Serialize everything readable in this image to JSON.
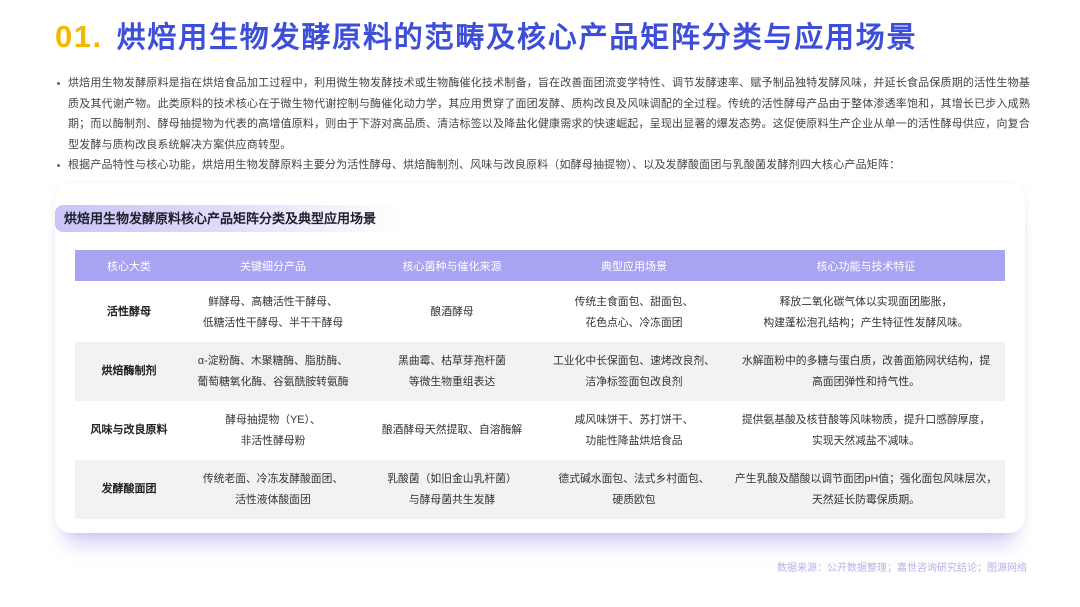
{
  "slide": {
    "number": "01.",
    "title": "烘焙用生物发酵原料的范畴及核心产品矩阵分类与应用场景"
  },
  "bullets": [
    "烘焙用生物发酵原料是指在烘焙食品加工过程中，利用微生物发酵技术或生物酶催化技术制备，旨在改善面团流变学特性、调节发酵速率、赋予制品独特发酵风味，并延长食品保质期的活性生物基质及其代谢产物。此类原料的技术核心在于微生物代谢控制与酶催化动力学，其应用贯穿了面团发酵、质构改良及风味调配的全过程。传统的活性酵母产品由于整体渗透率饱和，其增长已步入成熟期；而以酶制剂、酵母抽提物为代表的高增值原料，则由于下游对高品质、清洁标签以及降盐化健康需求的快速崛起，呈现出显著的爆发态势。这促使原料生产企业从单一的活性酵母供应，向复合型发酵与质构改良系统解决方案供应商转型。",
    "根据产品特性与核心功能，烘焙用生物发酵原料主要分为活性酵母、烘焙酶制剂、风味与改良原料（如酵母抽提物）、以及发酵酸面团与乳酸菌发酵剂四大核心产品矩阵："
  ],
  "card": {
    "title": "烘焙用生物发酵原料核心产品矩阵分类及典型应用场景",
    "table": {
      "headers": [
        "核心大类",
        "关键细分产品",
        "核心菌种与催化来源",
        "典型应用场景",
        "核心功能与技术特征"
      ],
      "rows": [
        [
          "活性酵母",
          "鲜酵母、高糖活性干酵母、\n低糖活性干酵母、半干干酵母",
          "酿酒酵母",
          "传统主食面包、甜面包、\n花色点心、冷冻面团",
          "释放二氧化碳气体以实现面团膨胀，\n构建蓬松泡孔结构；产生特征性发酵风味。"
        ],
        [
          "烘焙酶制剂",
          "α-淀粉酶、木聚糖酶、脂肪酶、\n葡萄糖氧化酶、谷氨酰胺转氨酶",
          "黑曲霉、枯草芽孢杆菌\n等微生物重组表达",
          "工业化中长保面包、速烤改良剂、\n洁净标签面包改良剂",
          "水解面粉中的多糖与蛋白质，改善面筋网状结构，提\n高面团弹性和持气性。"
        ],
        [
          "风味与改良原料",
          "酵母抽提物（YE）、\n非活性酵母粉",
          "酿酒酵母天然提取、自溶酶解",
          "咸风味饼干、苏打饼干、\n功能性降盐烘焙食品",
          "提供氨基酸及核苷酸等风味物质，提升口感醇厚度，\n实现天然减盐不减味。"
        ],
        [
          "发酵酸面团",
          "传统老面、冷冻发酵酸面团、\n活性液体酸面团",
          "乳酸菌（如旧金山乳杆菌）\n与酵母菌共生发酵",
          "德式碱水面包、法式乡村面包、\n硬质欧包",
          "产生乳酸及醋酸以调节面团pH值；强化面包风味层次，\n天然延长防霉保质期。"
        ]
      ]
    }
  },
  "footer": {
    "source": "数据来源：公开数据整理；嘉世咨询研究结论；图源网络"
  },
  "theme": {
    "title_color": "#3d4fd8",
    "number_color": "#f5b800",
    "header_bg": "#a8a4f1",
    "zebra_bg": "#f2f2f5",
    "footer_color": "#b4b0ea",
    "title_bar_color": "#c9c4f6"
  }
}
